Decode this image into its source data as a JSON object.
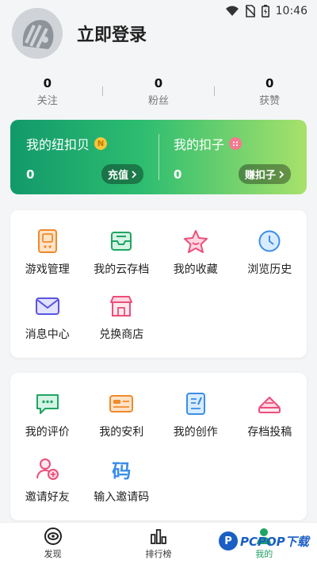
{
  "status_bar": {
    "time": "10:46"
  },
  "profile": {
    "login_text": "立即登录"
  },
  "stats": [
    {
      "value": "0",
      "label": "关注"
    },
    {
      "value": "0",
      "label": "粉丝"
    },
    {
      "value": "0",
      "label": "获赞"
    }
  ],
  "wallet": {
    "left": {
      "title": "我的纽扣贝",
      "badge": "N",
      "value": "0",
      "button": "充值"
    },
    "right": {
      "title": "我的扣子",
      "badge": "::",
      "value": "0",
      "button": "赚扣子"
    }
  },
  "card1": {
    "items": [
      {
        "label": "游戏管理",
        "icon": "game-manage-icon"
      },
      {
        "label": "我的云存档",
        "icon": "cloud-save-icon"
      },
      {
        "label": "我的收藏",
        "icon": "favorite-star-icon"
      },
      {
        "label": "浏览历史",
        "icon": "history-clock-icon"
      },
      {
        "label": "消息中心",
        "icon": "message-envelope-icon"
      },
      {
        "label": "兑换商店",
        "icon": "store-icon"
      }
    ]
  },
  "card2": {
    "items": [
      {
        "label": "我的评价",
        "icon": "review-chat-icon"
      },
      {
        "label": "我的安利",
        "icon": "recommend-card-icon"
      },
      {
        "label": "我的创作",
        "icon": "creation-pen-icon"
      },
      {
        "label": "存档投稿",
        "icon": "submit-save-icon"
      },
      {
        "label": "邀请好友",
        "icon": "invite-friend-icon"
      },
      {
        "label": "输入邀请码",
        "icon": "invite-code-icon",
        "glyph": "码"
      }
    ]
  },
  "bottom_nav": [
    {
      "label": "发现",
      "icon": "discover-icon"
    },
    {
      "label": "排行榜",
      "icon": "ranking-icon"
    },
    {
      "label": "我的",
      "icon": "profile-icon",
      "active": true
    }
  ],
  "watermark": {
    "text": "PCPOP下载"
  },
  "colors": {
    "accent": "#1fa463",
    "wallet_start": "#12996b",
    "wallet_end": "#a8e26b"
  }
}
